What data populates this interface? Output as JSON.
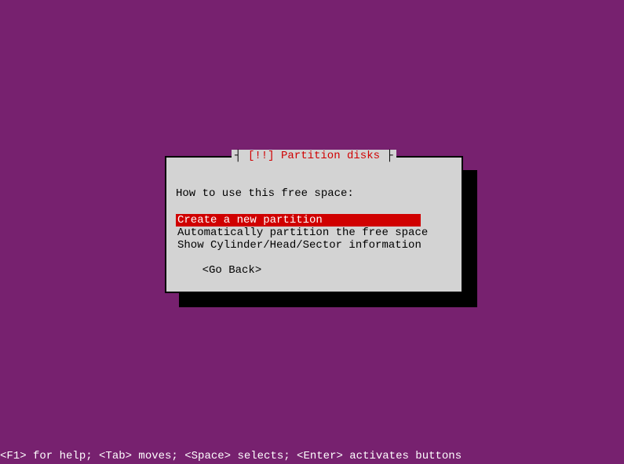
{
  "dialog": {
    "title_marker": "[!!]",
    "title_text": "Partition disks",
    "prompt": "How to use this free space:",
    "options": [
      "Create a new partition",
      "Automatically partition the free space",
      "Show Cylinder/Head/Sector information"
    ],
    "goback_label": "    <Go Back>",
    "selected_index": 0
  },
  "statusbar": "<F1> for help; <Tab> moves; <Space> selects; <Enter> activates buttons"
}
